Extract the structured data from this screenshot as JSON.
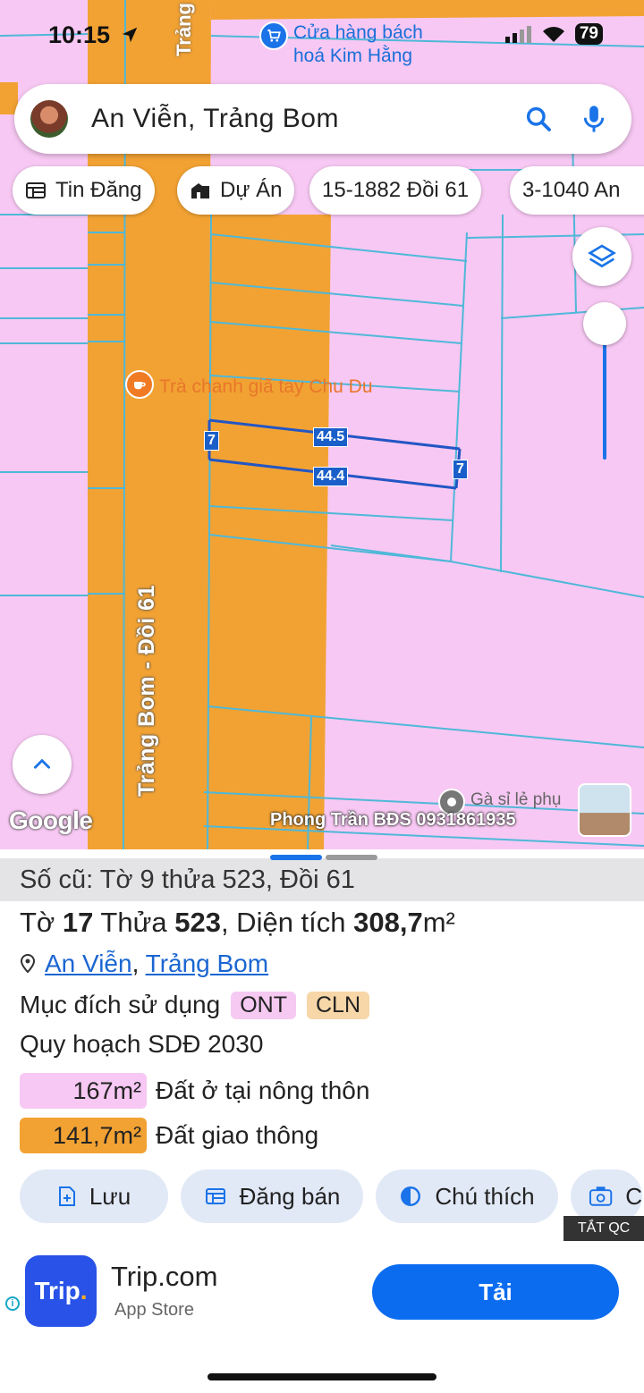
{
  "status_bar": {
    "time": "10:15",
    "battery": "79"
  },
  "map": {
    "poi_store": "Cửa hàng bách\nhoá Kim Hằng",
    "poi_cafe": "Trà chanh giã tay Chu Du",
    "poi_bottom": "Gà sỉ lẻ phụ",
    "road_name": "Trảng Bom - Đồi 61",
    "road_top": "Trảng",
    "dimensions": {
      "top": "44.5",
      "bottom": "44.4",
      "left": "7",
      "right": "7"
    },
    "google_logo": "Google",
    "watermark": "Phong Trần BĐS 0931861935",
    "colors": {
      "residential": "#f7c8f3",
      "road": "#f2a233",
      "parcel_line": "#4fb8d8",
      "selected_line": "#2356c4"
    }
  },
  "search": {
    "value": "An Viễn, Trảng Bom"
  },
  "chips": [
    {
      "label": "Tin Đăng",
      "icon": "listing-icon"
    },
    {
      "label": "Dự Án",
      "icon": "building-icon"
    },
    {
      "label": "15-1882 Đồi 61"
    },
    {
      "label": "3-1040 An"
    }
  ],
  "sheet": {
    "old_ref": "Số cũ: Tờ 9 thửa 523, Đồi 61",
    "title_prefix": "Tờ ",
    "sheet_no": "17",
    "parcel_label": " Thửa ",
    "parcel_no": "523",
    "area_label": ", Diện tích ",
    "area_value": "308,7",
    "area_unit": "m²",
    "location_ward": "An Viễn",
    "location_sep": ", ",
    "location_district": "Trảng Bom",
    "purpose_label": "Mục đích sử dụng",
    "purpose_tags": [
      {
        "code": "ONT",
        "color": "#f5c9f1"
      },
      {
        "code": "CLN",
        "color": "#f7d6a8"
      }
    ],
    "plan_label": "Quy hoạch SDĐ 2030",
    "plan_items": [
      {
        "area": "167m²",
        "label": "Đất ở tại nông thôn",
        "color": "#f7c8f3"
      },
      {
        "area": "141,7m²",
        "label": "Đất giao thông",
        "color": "#f2a233"
      }
    ],
    "actions": [
      {
        "label": "Lưu",
        "icon": "save-icon"
      },
      {
        "label": "Đăng bán",
        "icon": "listing-icon"
      },
      {
        "label": "Chú thích",
        "icon": "legend-icon"
      },
      {
        "label": "C",
        "icon": "camera-icon"
      }
    ],
    "close_ads": "TẮT QC"
  },
  "ad": {
    "logo_text": "Trip",
    "logo_dot": ".",
    "title": "Trip.com",
    "subtitle": "App Store",
    "button": "Tải"
  }
}
